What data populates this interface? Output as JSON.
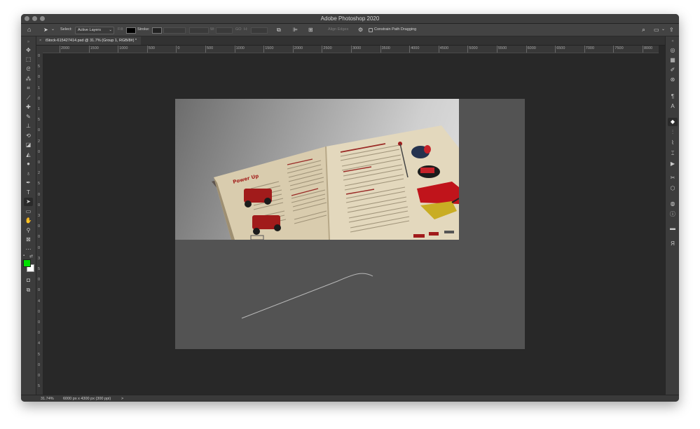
{
  "window": {
    "title": "Adobe Photoshop 2020"
  },
  "options_bar": {
    "select_label": "Select:",
    "select_value": "Active Layers",
    "fill_label": "Fill:",
    "stroke_label": "Stroke:",
    "w_label": "W:",
    "go_label": "GO",
    "h_label": "H:",
    "align_edges_label": "Align Edges",
    "constrain_label": "Constrain Path Dragging"
  },
  "document_tab": {
    "close_symbol": "×",
    "title": "iStock-615427414.psd @ 31.7% (Group 1, RGB/8#) *"
  },
  "rulers": {
    "horizontal_ticks": [
      "2000",
      "1500",
      "1000",
      "500",
      "0",
      "500",
      "1000",
      "1500",
      "2000",
      "2500",
      "3000",
      "3500",
      "4000",
      "4500",
      "5000",
      "5500",
      "6000",
      "6500",
      "7000",
      "7500",
      "8000"
    ],
    "vertical_ticks": [
      "0",
      "5",
      "0",
      "1",
      "0",
      "1",
      "5",
      "0",
      "2",
      "0",
      "0",
      "2",
      "5",
      "0",
      "0",
      "3",
      "0",
      "0",
      "0",
      "3",
      "5",
      "0",
      "0",
      "4",
      "0",
      "0",
      "0",
      "4",
      "5",
      "0",
      "0",
      "5"
    ]
  },
  "status_bar": {
    "zoom": "31.74%",
    "doc_info": "6000 px x 4300 px (300 ppi)",
    "arrow": ">"
  },
  "colors": {
    "foreground": "#00e000",
    "background": "#ffffff",
    "path_stroke": "#b8b8b8"
  },
  "tools": [
    "move-tool-icon",
    "marquee-tool-icon",
    "lasso-tool-icon",
    "magic-wand-icon",
    "crop-tool-icon",
    "eyedropper-icon",
    "healing-brush-icon",
    "brush-tool-icon",
    "clone-stamp-icon",
    "history-brush-icon",
    "eraser-icon",
    "paint-bucket-icon",
    "blur-tool-icon",
    "dodge-tool-icon",
    "pen-tool-icon",
    "type-tool-icon",
    "path-selection-icon",
    "rectangle-tool-icon",
    "hand-tool-icon",
    "zoom-tool-icon",
    "frame-tool-icon",
    "more-tools-icon"
  ],
  "right_panels": [
    "3d-icon",
    "grid-icon",
    "brush-panel-icon",
    "navigator-icon",
    "paragraph-icon",
    "character-icon",
    "layers-icon",
    "channels-icon",
    "paths-icon",
    "transform-icon",
    "play-icon",
    "tools-icon",
    "cube-icon",
    "color-icon",
    "info-icon",
    "swatches-icon",
    "glyph-icon"
  ],
  "magazine": {
    "heading": "Power Up"
  }
}
